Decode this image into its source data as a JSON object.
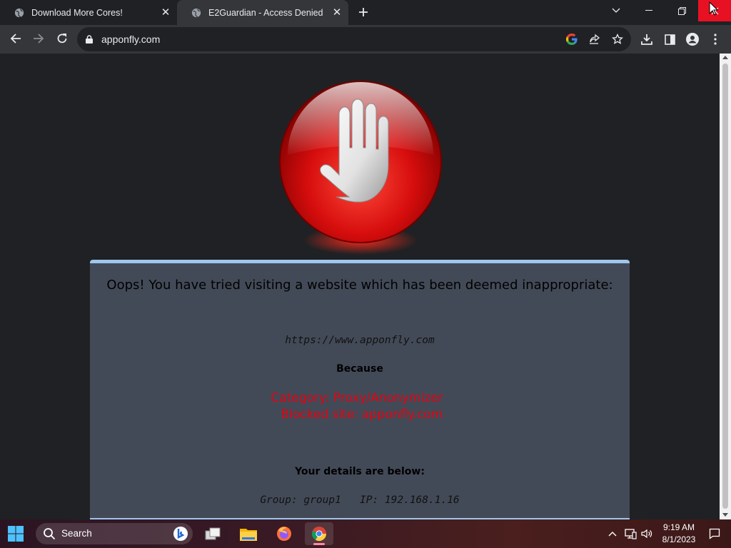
{
  "browser": {
    "tabs": [
      {
        "title": "Download More Cores!",
        "active": false
      },
      {
        "title": "E2Guardian - Access Denied",
        "active": true
      }
    ],
    "address": "apponfly.com"
  },
  "page": {
    "headline": "Oops! You have tried visiting a website which has been deemed inappropriate:",
    "blocked_url": "https://www.apponfly.com",
    "because_label": "Because",
    "reason_category": "Category: Proxy/Anonymizer",
    "reason_site": "Blocked site: apponfly.com",
    "details_label": "Your details are below:",
    "group_info": "Group: group1   IP: 192.168.1.16",
    "colors": {
      "panel_bg": "#434a57",
      "panel_border": "#9fc6ee",
      "reason_text": "#e8000f",
      "page_bg": "#202124"
    }
  },
  "taskbar": {
    "search_label": "Search",
    "time": "9:19 AM",
    "date": "8/1/2023",
    "apps": [
      "task-view",
      "file-explorer",
      "firefox",
      "chrome"
    ]
  }
}
